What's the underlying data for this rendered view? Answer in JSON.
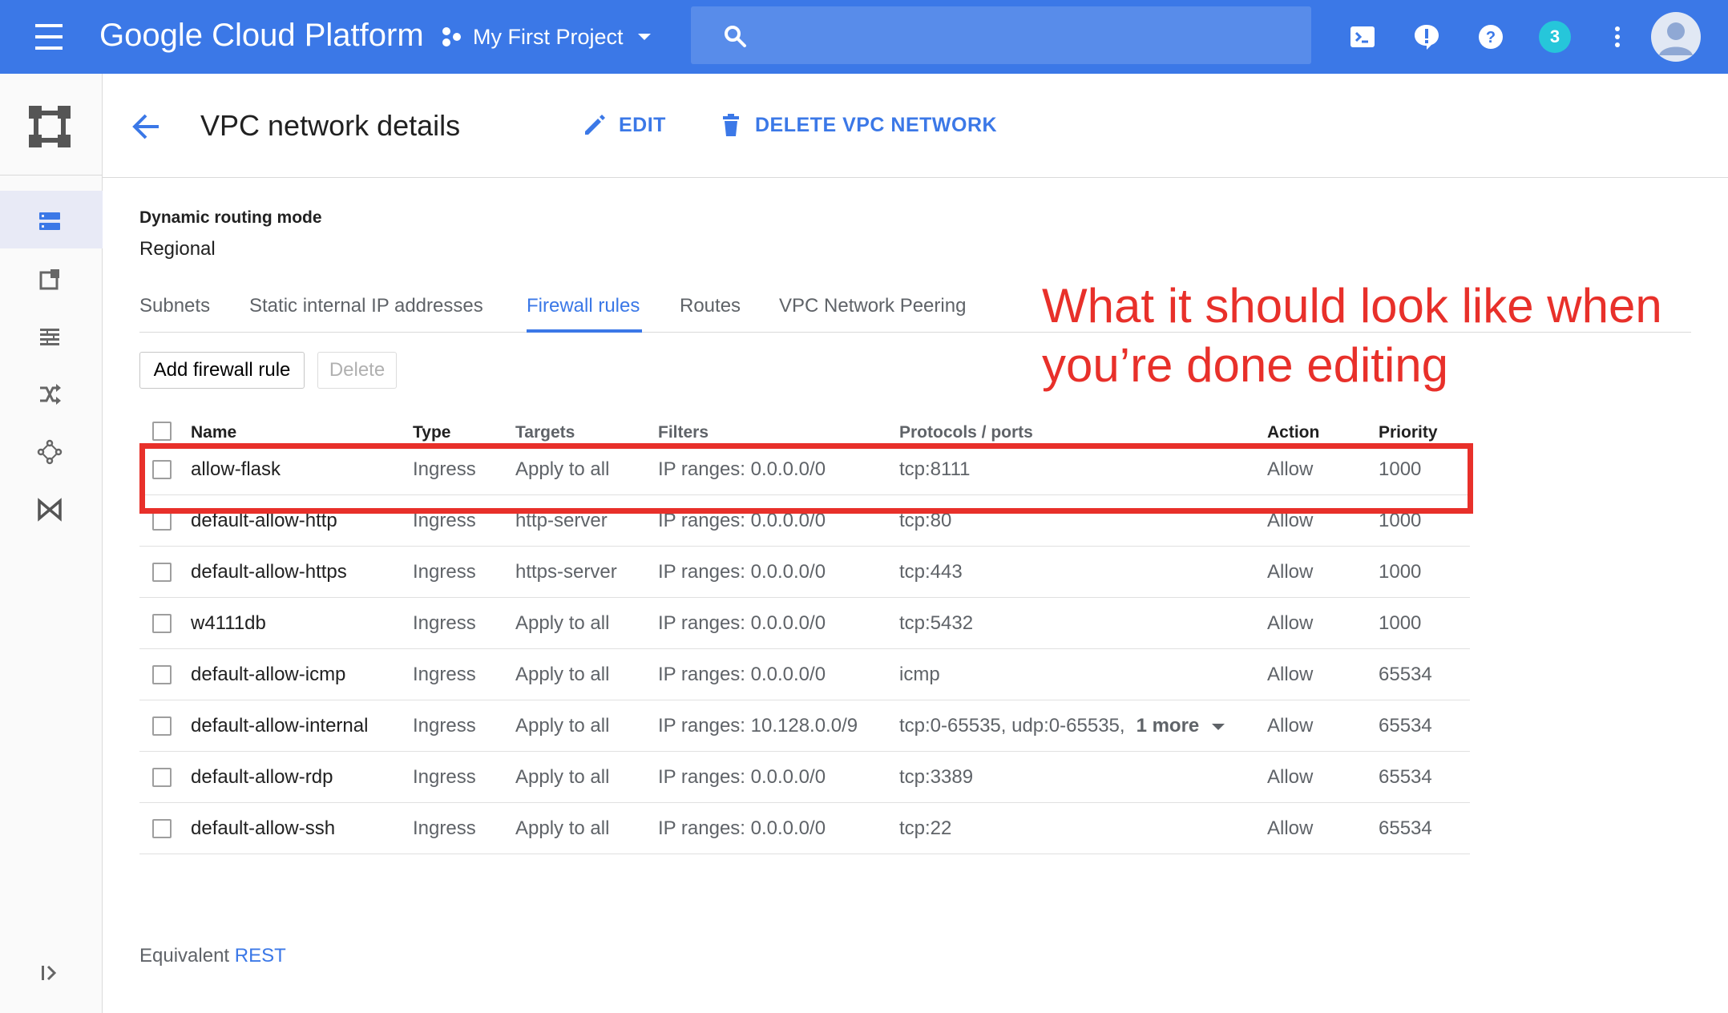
{
  "topbar": {
    "brand": "Google Cloud Platform",
    "project": "My First Project",
    "search_placeholder": "",
    "notifications_count": "3"
  },
  "header": {
    "title": "VPC network details",
    "edit_label": "EDIT",
    "delete_label": "DELETE VPC NETWORK"
  },
  "routing": {
    "label": "Dynamic routing mode",
    "value": "Regional"
  },
  "tabs": [
    {
      "label": "Subnets"
    },
    {
      "label": "Static internal IP addresses"
    },
    {
      "label": "Firewall rules"
    },
    {
      "label": "Routes"
    },
    {
      "label": "VPC Network Peering"
    }
  ],
  "active_tab": "Firewall rules",
  "actions": {
    "add_label": "Add firewall rule",
    "delete_label": "Delete"
  },
  "table": {
    "columns": {
      "name": "Name",
      "type": "Type",
      "targets": "Targets",
      "filters": "Filters",
      "protocols": "Protocols / ports",
      "action": "Action",
      "priority": "Priority"
    },
    "rows": [
      {
        "name": "allow-flask",
        "type": "Ingress",
        "targets": "Apply to all",
        "filters": "IP ranges: 0.0.0.0/0",
        "protocols": "tcp:8111",
        "action": "Allow",
        "priority": "1000"
      },
      {
        "name": "default-allow-http",
        "type": "Ingress",
        "targets": "http-server",
        "filters": "IP ranges: 0.0.0.0/0",
        "protocols": "tcp:80",
        "action": "Allow",
        "priority": "1000"
      },
      {
        "name": "default-allow-https",
        "type": "Ingress",
        "targets": "https-server",
        "filters": "IP ranges: 0.0.0.0/0",
        "protocols": "tcp:443",
        "action": "Allow",
        "priority": "1000"
      },
      {
        "name": "w4111db",
        "type": "Ingress",
        "targets": "Apply to all",
        "filters": "IP ranges: 0.0.0.0/0",
        "protocols": "tcp:5432",
        "action": "Allow",
        "priority": "1000"
      },
      {
        "name": "default-allow-icmp",
        "type": "Ingress",
        "targets": "Apply to all",
        "filters": "IP ranges: 0.0.0.0/0",
        "protocols": "icmp",
        "action": "Allow",
        "priority": "65534"
      },
      {
        "name": "default-allow-internal",
        "type": "Ingress",
        "targets": "Apply to all",
        "filters": "IP ranges: 10.128.0.0/9",
        "protocols": "tcp:0-65535, udp:0-65535,",
        "more": "1 more",
        "action": "Allow",
        "priority": "65534"
      },
      {
        "name": "default-allow-rdp",
        "type": "Ingress",
        "targets": "Apply to all",
        "filters": "IP ranges: 0.0.0.0/0",
        "protocols": "tcp:3389",
        "action": "Allow",
        "priority": "65534"
      },
      {
        "name": "default-allow-ssh",
        "type": "Ingress",
        "targets": "Apply to all",
        "filters": "IP ranges: 0.0.0.0/0",
        "protocols": "tcp:22",
        "action": "Allow",
        "priority": "65534"
      }
    ]
  },
  "annotation": {
    "text": "What it should look like when you’re done editing",
    "color": "#e8302a"
  },
  "footer": {
    "prefix": "Equivalent",
    "link": "REST"
  },
  "colors": {
    "primary": "#3b78e7",
    "badge": "#26c6da",
    "highlight": "#e8302a"
  },
  "icons": {
    "menu": "hamburger-icon",
    "project": "project-hexagon-icon",
    "search": "search-icon",
    "cloud_shell": "terminal-icon",
    "feedback": "alert-bubble-icon",
    "help": "help-icon",
    "more": "more-vert-icon",
    "rail": [
      "vpc-network-icon",
      "external-ip-icon",
      "firewall-icon",
      "routes-icon",
      "peering-icon",
      "vpn-icon"
    ],
    "collapse": "collapse-rail-icon"
  }
}
